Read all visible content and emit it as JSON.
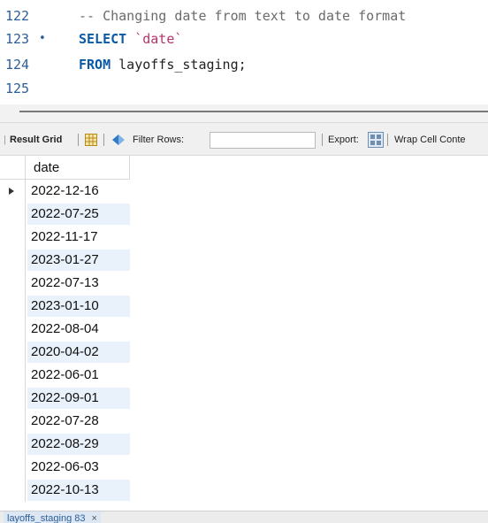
{
  "editor": {
    "lines": [
      {
        "number": "122",
        "marker": "",
        "tokens": [
          {
            "text": "-- Changing date from text to date format",
            "kind": "comment"
          }
        ]
      },
      {
        "number": "123",
        "marker": "•",
        "tokens": [
          {
            "text": "SELECT",
            "kind": "keyword"
          },
          {
            "text": " ",
            "kind": "plain"
          },
          {
            "text": "`date`",
            "kind": "string"
          }
        ]
      },
      {
        "number": "124",
        "marker": "",
        "tokens": [
          {
            "text": "FROM",
            "kind": "keyword"
          },
          {
            "text": " layoffs_staging;",
            "kind": "plain"
          }
        ]
      },
      {
        "number": "125",
        "marker": "",
        "tokens": []
      }
    ]
  },
  "toolbar": {
    "result_grid_label": "Result Grid",
    "grid_icon": "grid-view-icon",
    "refresh_icon": "refresh-icon",
    "filter_label": "Filter Rows:",
    "filter_value": "",
    "export_label": "Export:",
    "export_icon": "export-icon",
    "wrap_label": "Wrap Cell Conte"
  },
  "grid": {
    "columns": [
      "date"
    ],
    "rows": [
      "2022-12-16",
      "2022-07-25",
      "2022-11-17",
      "2023-01-27",
      "2022-07-13",
      "2023-01-10",
      "2022-08-04",
      "2020-04-02",
      "2022-06-01",
      "2022-09-01",
      "2022-07-28",
      "2022-08-29",
      "2022-06-03",
      "2022-10-13"
    ]
  },
  "bottom_tab": {
    "label": "layoffs_staging 83",
    "close": "×"
  },
  "colors": {
    "line_number": "#2b5f98",
    "keyword": "#0a5aa8",
    "string": "#b8336a",
    "comment": "#6b6b6b",
    "alt_row": "#e9f1fb"
  }
}
